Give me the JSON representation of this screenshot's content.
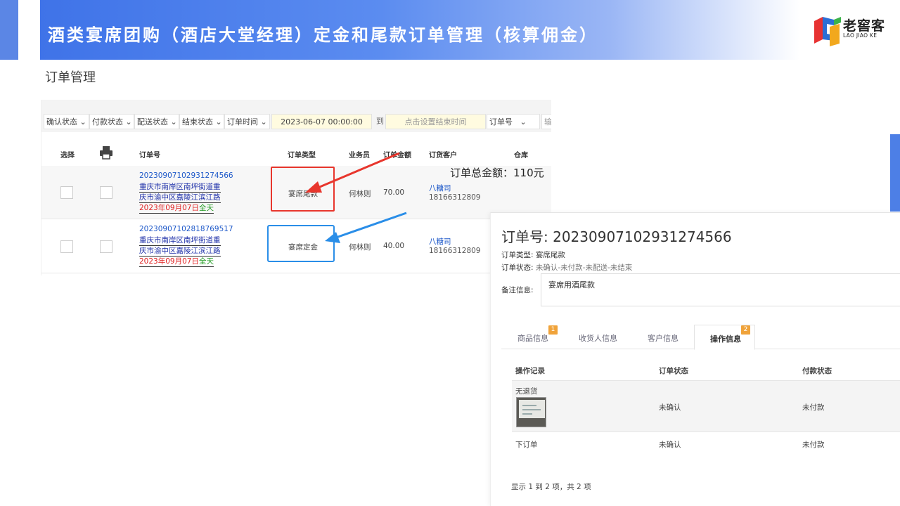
{
  "header": {
    "title": "酒类宴席团购（酒店大堂经理）定金和尾款订单管理（核算佣金）",
    "logo_cn": "老窖客",
    "logo_en": "LAO JIAO KE",
    "accent_color": "#3f73e8"
  },
  "page": {
    "subtitle": "订单管理"
  },
  "filters": {
    "confirm_status": "确认状态",
    "pay_status": "付款状态",
    "delivery_status": "配送状态",
    "end_status": "结束状态",
    "order_time": "订单时间",
    "start_date": "2023-06-07 00:00:00",
    "to_label": "到",
    "end_date_placeholder": "点击设置结束时间",
    "search_field": "订单号",
    "cut_off": "输"
  },
  "table": {
    "headers": {
      "select": "选择",
      "order_no": "订单号",
      "order_type": "订单类型",
      "salesman": "业务员",
      "amount": "订单金额",
      "customer": "订货客户",
      "warehouse": "仓库"
    },
    "total_label": "订单总金额：110元",
    "rows": [
      {
        "order_no": "20230907102931274566",
        "addr1": "重庆市南岸区南坪街道重",
        "addr2": "庆市渝中区嘉陵江滨江路",
        "date": "2023年09月07日",
        "slot": "全天",
        "type": "宴席尾款",
        "salesman": "何林则",
        "amount": "70.00",
        "customer": "八糖司",
        "phone": "18166312809"
      },
      {
        "order_no": "20230907102818769517",
        "addr1": "重庆市南岸区南坪街道重",
        "addr2": "庆市渝中区嘉陵江滨江路",
        "date": "2023年09月07日",
        "slot": "全天",
        "type": "宴席定金",
        "salesman": "何林则",
        "amount": "40.00",
        "customer": "八糖司",
        "phone": "18166312809"
      }
    ]
  },
  "detail": {
    "title": "订单号: 20230907102931274566",
    "type_label": "订单类型:",
    "type_value": "宴席尾款",
    "status_label": "订单状态:",
    "status_value": "未确认-未付款-未配送-未结束",
    "remark_label": "备注信息:",
    "remark_value": "宴席用酒尾款",
    "tabs": [
      {
        "label": "商品信息",
        "badge": "1"
      },
      {
        "label": "收货人信息"
      },
      {
        "label": "客户信息"
      },
      {
        "label": "操作信息",
        "badge": "2"
      }
    ],
    "op_headers": {
      "record": "操作记录",
      "order_status": "订单状态",
      "pay_status": "付款状态"
    },
    "op_rows": [
      {
        "record": "无退货",
        "order_status": "未确认",
        "pay_status": "未付款"
      },
      {
        "record": "下订单",
        "order_status": "未确认",
        "pay_status": "未付款"
      }
    ],
    "footer": "显示 1 到 2 项，共 2 项"
  }
}
